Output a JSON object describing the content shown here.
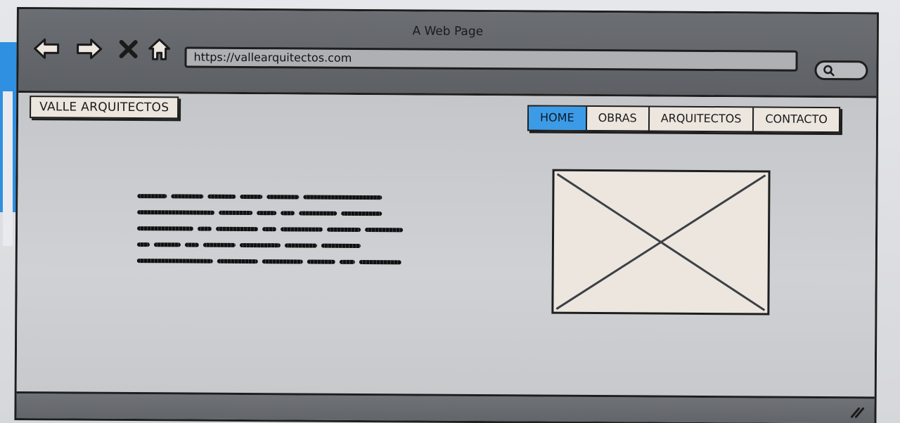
{
  "window": {
    "title": "A Web Page"
  },
  "toolbar": {
    "back_icon": "back-arrow-icon",
    "forward_icon": "forward-arrow-icon",
    "stop_icon": "close-icon",
    "home_icon": "home-icon"
  },
  "address_bar": {
    "url": "https://vallearquitectos.com"
  },
  "search": {
    "icon": "search-icon"
  },
  "site": {
    "brand": "VALLE ARQUITECTOS",
    "nav": [
      {
        "label": "HOME",
        "active": true
      },
      {
        "label": "OBRAS",
        "active": false
      },
      {
        "label": "ARQUITECTOS",
        "active": false
      },
      {
        "label": "CONTACTO",
        "active": false
      }
    ],
    "image_placeholder": "image-placeholder-icon"
  },
  "colors": {
    "active_tab": "#3c9be6",
    "chrome": "#62656a",
    "content_bg": "#c8cacd"
  }
}
